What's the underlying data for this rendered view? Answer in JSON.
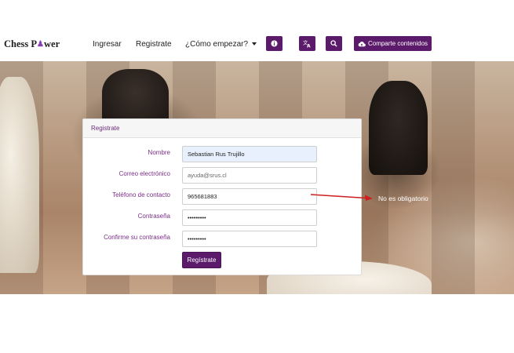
{
  "navbar": {
    "brand": {
      "before": "Chess P",
      "after": "wer"
    },
    "links": {
      "ingresar": "Ingresar",
      "registrate": "Registrate",
      "como_empezar": "¿Cómo empezar?"
    },
    "share_label": "Comparte contenidos",
    "icons": [
      "info-icon",
      "translate-icon",
      "search-icon",
      "cloud-upload-icon"
    ],
    "accent_color": "#5b1a6a"
  },
  "form": {
    "header": "Registrate",
    "fields": [
      {
        "label": "Nombre",
        "value": "Sebastian Rus Trujillo",
        "placeholder": ""
      },
      {
        "label": "Correo electrónico",
        "value": "",
        "placeholder": "ayuda@srus.cl"
      },
      {
        "label": "Teléfono de contacto",
        "value": "965681883",
        "placeholder": ""
      },
      {
        "label": "Contraseña",
        "value": "•••••••••",
        "placeholder": ""
      },
      {
        "label": "Confirme su contraseña",
        "value": "•••••••••",
        "placeholder": ""
      }
    ],
    "submit_label": "Regístrate"
  },
  "annotation": {
    "text": "No es obligatorio",
    "arrow_color": "#cc1f1f"
  }
}
